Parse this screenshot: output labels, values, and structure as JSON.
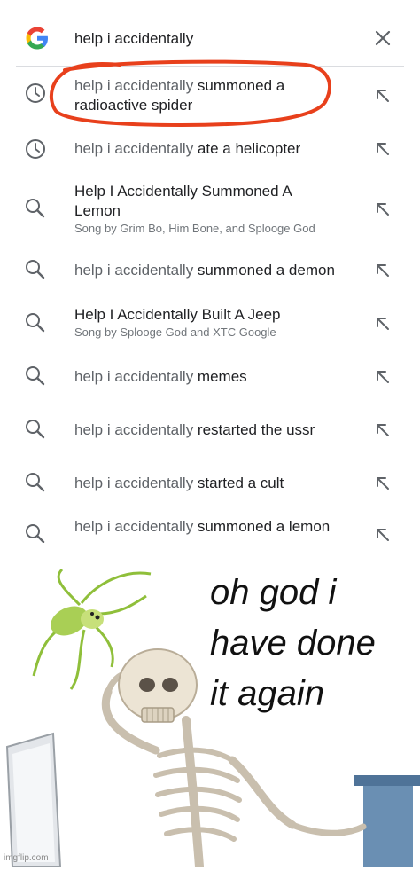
{
  "search": {
    "query": "help i accidentally"
  },
  "suggestions": [
    {
      "type": "history",
      "prefix": "help i accidentally",
      "rest": " summoned a",
      "line2": "radioactive spider",
      "highlighted": true
    },
    {
      "type": "history",
      "prefix": "help i accidentally",
      "rest": " ate a helicopter"
    },
    {
      "type": "search",
      "title_line1": "Help I Accidentally Summoned A",
      "title_line2": "Lemon",
      "subtitle": "Song by Grim Bo, Him Bone, and Splooge God"
    },
    {
      "type": "search",
      "prefix": "help i accidentally",
      "rest": " summoned a demon"
    },
    {
      "type": "search",
      "title_line1": "Help I Accidentally Built A Jeep",
      "subtitle": "Song by Splooge God and XTC Google"
    },
    {
      "type": "search",
      "prefix": "help i accidentally",
      "rest": " memes"
    },
    {
      "type": "search",
      "prefix": "help i accidentally",
      "rest": " restarted the ussr"
    },
    {
      "type": "search",
      "prefix": "help i accidentally",
      "rest": " started a cult"
    },
    {
      "type": "search",
      "prefix": "help i accidentally",
      "rest": " summoned a lemon"
    }
  ],
  "meme": {
    "caption": "oh god i\nhave done\nit again",
    "watermark": "imgflip.com"
  },
  "colors": {
    "highlight_circle": "#e8401c",
    "icon_gray": "#5f6368",
    "spider_green": "#8fbf3a"
  }
}
